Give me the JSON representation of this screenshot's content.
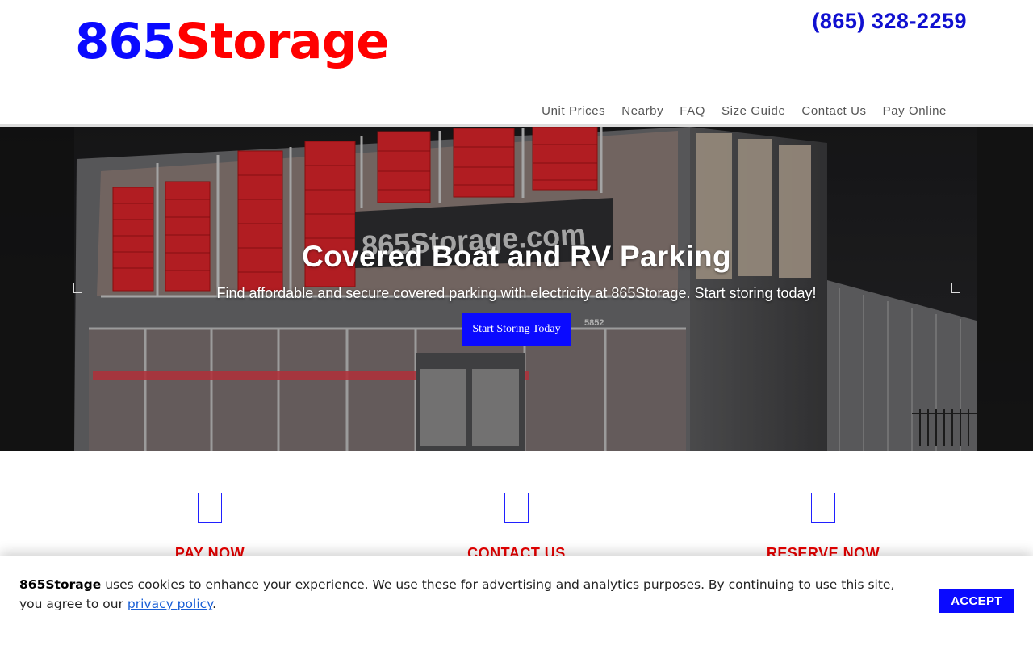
{
  "brand": {
    "num": "865",
    "word": "Storage"
  },
  "phone": "(865) 328-2259",
  "nav": {
    "items": [
      {
        "label": "Unit Prices"
      },
      {
        "label": "Nearby"
      },
      {
        "label": "FAQ"
      },
      {
        "label": "Size Guide"
      },
      {
        "label": "Contact Us"
      },
      {
        "label": "Pay Online"
      }
    ]
  },
  "hero": {
    "title": "Covered Boat and RV Parking",
    "subtitle": "Find affordable and secure covered parking with electricity at 865Storage. Start storing today!",
    "button": "Start Storing Today",
    "sign_text": "865Storage.com",
    "building_number": "5852"
  },
  "features": [
    {
      "label": "PAY NOW"
    },
    {
      "label": "CONTACT US"
    },
    {
      "label": "RESERVE NOW"
    }
  ],
  "cookie": {
    "brand": "865Storage",
    "text": " uses cookies to enhance your experience. We use these for advertising and analytics purposes. By continuing to use this site, you agree to our ",
    "link": "privacy policy",
    "end": ".",
    "accept": "ACCEPT"
  },
  "colors": {
    "brand_blue": "#0a0aff",
    "brand_red": "#ff0000",
    "feature_red": "#e60000"
  }
}
